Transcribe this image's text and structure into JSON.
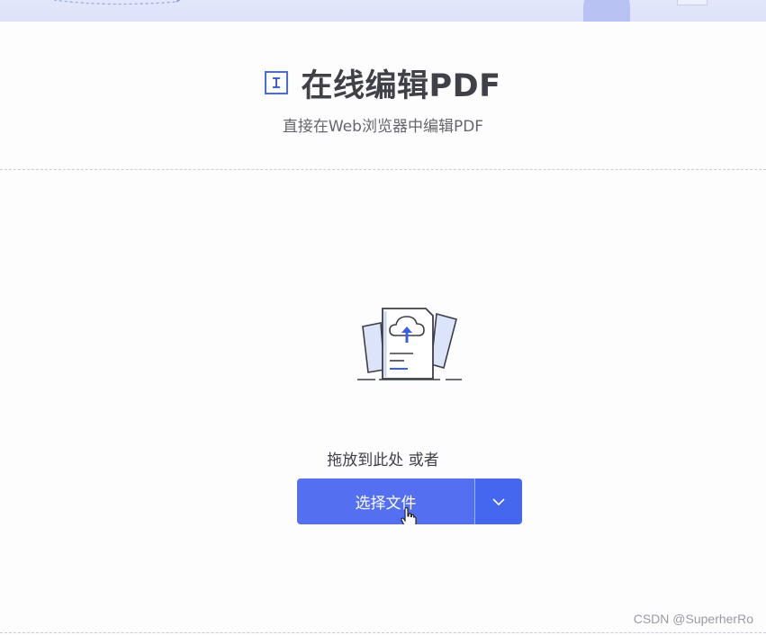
{
  "header": {
    "title": "在线编辑PDF",
    "subtitle": "直接在Web浏览器中编辑PDF",
    "tool_icon": "text-cursor-icon"
  },
  "upload": {
    "illustration_icon": "cloud-upload-document-icon",
    "drop_hint": "拖放到此处 或者",
    "choose_file_label": "选择文件",
    "dropdown_icon": "chevron-down-icon"
  },
  "watermark": "CSDN @SuperherRo",
  "colors": {
    "accent": "#5470f0",
    "accent_dark": "#4566ee",
    "title_text": "#404148"
  }
}
